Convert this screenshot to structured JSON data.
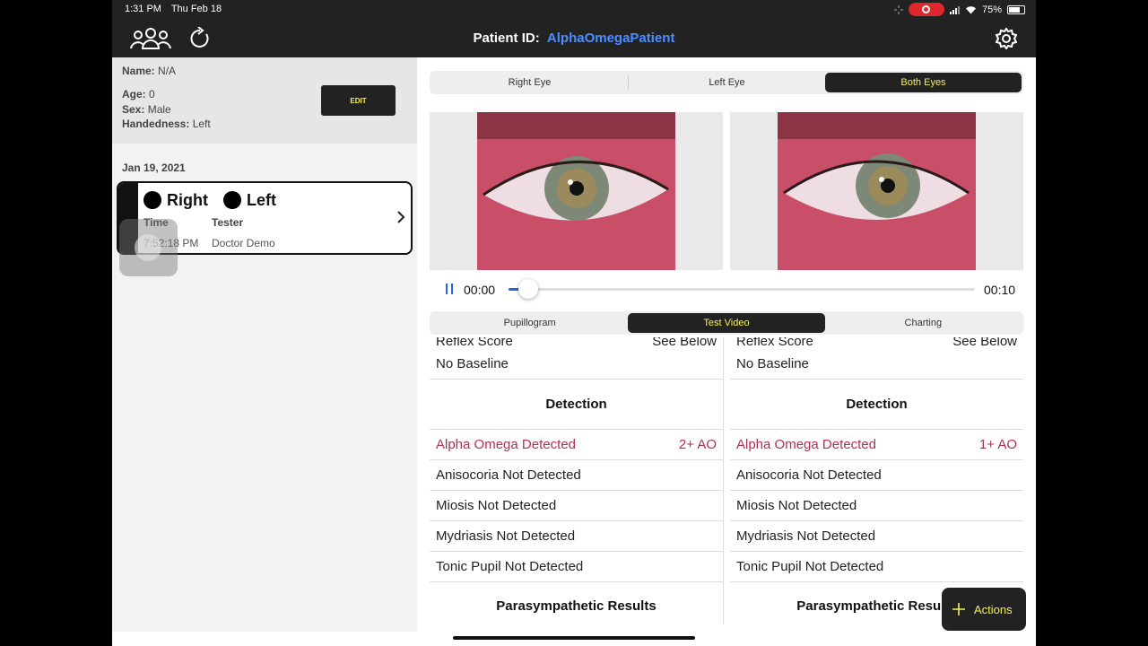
{
  "status_bar": {
    "time": "1:31 PM",
    "date": "Thu Feb 18",
    "battery": "75%"
  },
  "nav": {
    "patient_id_label": "Patient ID:",
    "patient_id_value": "AlphaOmegaPatient"
  },
  "patient": {
    "name_label": "Name:",
    "name_value": "N/A",
    "age_label": "Age:",
    "age_value": "0",
    "sex_label": "Sex:",
    "sex_value": "Male",
    "handedness_label": "Handedness:",
    "handedness_value": "Left",
    "edit_label": "EDIT"
  },
  "session": {
    "date": "Jan 19, 2021",
    "right_label": "Right",
    "left_label": "Left",
    "time_header": "Time",
    "tester_header": "Tester",
    "time_value": "7:52:18 PM",
    "tester_value": "Doctor Demo"
  },
  "eye_tabs": {
    "right": "Right Eye",
    "left": "Left Eye",
    "both": "Both Eyes",
    "selected": "both"
  },
  "player": {
    "current": "00:00",
    "duration": "00:10",
    "progress": 0.03
  },
  "view_tabs": {
    "pupillogram": "Pupillogram",
    "test_video": "Test Video",
    "charting": "Charting",
    "selected": "test_video"
  },
  "results_left": {
    "cut_label": "Reflex Score",
    "cut_value": "See Below",
    "baseline": "No Baseline",
    "detection_heading": "Detection",
    "alpha_omega": "Alpha Omega  Detected",
    "alpha_omega_score": "2+ AO",
    "anisocoria": "Anisocoria Not Detected",
    "miosis": "Miosis Not Detected",
    "mydriasis": "Mydriasis Not Detected",
    "tonic": "Tonic Pupil Not Detected",
    "parasympathetic_heading": "Parasympathetic Results"
  },
  "results_right": {
    "cut_label": "Reflex Score",
    "cut_value": "See Below",
    "baseline": "No Baseline",
    "detection_heading": "Detection",
    "alpha_omega": "Alpha Omega  Detected",
    "alpha_omega_score": "1+ AO",
    "anisocoria": "Anisocoria Not Detected",
    "miosis": "Miosis Not Detected",
    "mydriasis": "Mydriasis Not Detected",
    "tonic": "Tonic Pupil Not Detected",
    "parasympathetic_heading": "Parasympathetic Results"
  },
  "actions_label": "Actions",
  "colors": {
    "accent": "#f4ef5c",
    "link": "#4a8fff",
    "detected": "#b03050",
    "dark": "#222222"
  }
}
